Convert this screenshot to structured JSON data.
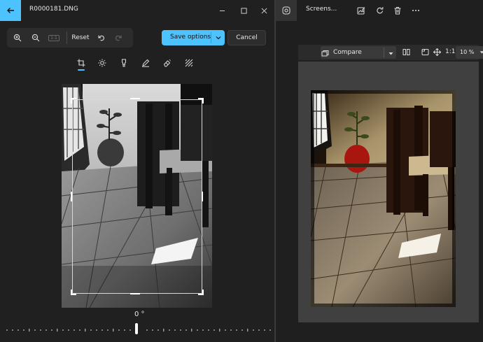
{
  "left_window": {
    "title": "R0000181.DNG",
    "toolbar": {
      "reset_label": "Reset",
      "actual_size_label": "1:1"
    },
    "save_options_label": "Save options",
    "cancel_label": "Cancel",
    "edit_tabs": [
      "crop-icon",
      "brightness-icon",
      "filter-icon",
      "markup-icon",
      "erase-icon",
      "background-icon"
    ],
    "angle_label": "0 °"
  },
  "right_window": {
    "title": "Screens...",
    "toolbar": {
      "compare_label": "Compare",
      "one_to_one_label": "1:1",
      "zoom_value": "10 %"
    }
  },
  "colors": {
    "accent": "#4cc2ff",
    "background": "#202020"
  }
}
